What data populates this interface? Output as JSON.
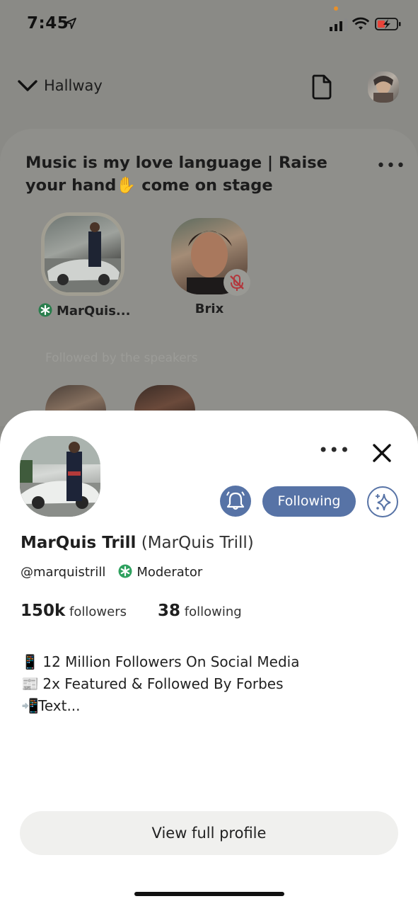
{
  "status_bar": {
    "time": "7:45"
  },
  "header": {
    "hallway_label": "Hallway"
  },
  "room": {
    "title": "Music is my love language | Raise your hand✋ come on stage",
    "more_label": "•••",
    "speakers": [
      {
        "name": "MarQuis..."
      },
      {
        "name": "Brix"
      }
    ],
    "followed_by_label": "Followed by the speakers"
  },
  "profile": {
    "more_label": "•••",
    "following_button": "Following",
    "name": "MarQuis Trill",
    "name_paren": "(MarQuis Trill)",
    "handle": "@marquistrill",
    "role": "Moderator",
    "followers_count": "150k",
    "followers_label": "followers",
    "following_count": "38",
    "following_label": "following",
    "bio": [
      {
        "emoji": "📱",
        "text": " 12 Million Followers On Social Media"
      },
      {
        "emoji": "📰",
        "text": " 2x Featured & Followed By Forbes"
      },
      {
        "emoji": "📲",
        "text": "Text..."
      }
    ],
    "view_full_profile": "View full profile"
  },
  "colors": {
    "accent": "#5773a6",
    "moderator_green": "#2fa15f",
    "sheet_bg": "#ffffff"
  }
}
